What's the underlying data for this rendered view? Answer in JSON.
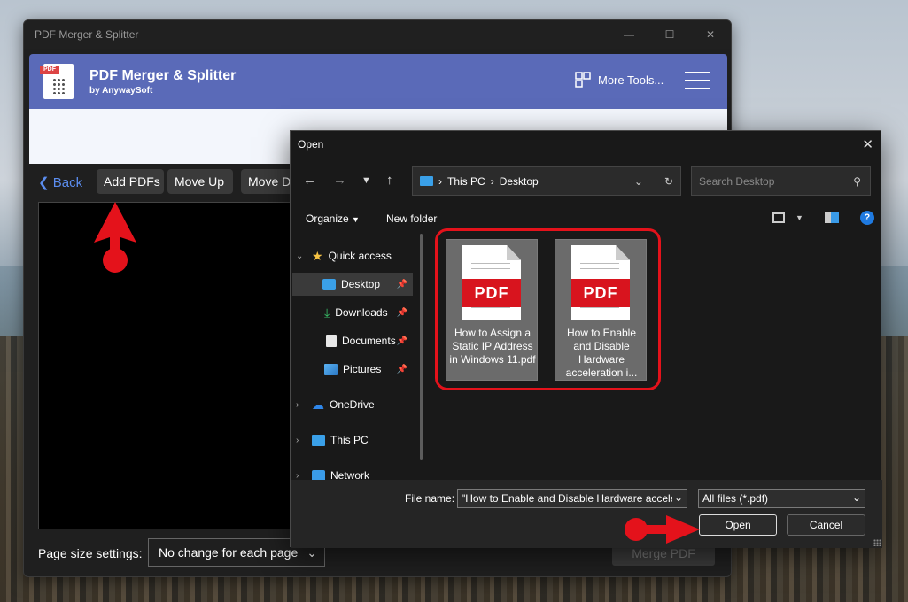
{
  "app": {
    "window_title": "PDF Merger & Splitter",
    "name": "PDF Merger & Splitter",
    "byline": "by AnywaySoft",
    "logo_tab": "PDF",
    "more_tools": "More Tools...",
    "toolbar": {
      "back": "Back",
      "add_pdfs": "Add PDFs",
      "move_up": "Move Up",
      "move_down": "Move D"
    },
    "page_size_label": "Page size settings:",
    "page_size_value": "No change for each page",
    "merge": "Merge PDF",
    "accent_color": "#5a6ab8"
  },
  "dialog": {
    "title": "Open",
    "breadcrumb": [
      "This PC",
      "Desktop"
    ],
    "search_placeholder": "Search Desktop",
    "organize": "Organize",
    "new_folder": "New folder",
    "nav": [
      {
        "label": "Quick access",
        "icon": "star-icon",
        "pinned": false
      },
      {
        "label": "Desktop",
        "icon": "desktop-icon",
        "pinned": true,
        "selected": true
      },
      {
        "label": "Downloads",
        "icon": "download-icon",
        "pinned": true
      },
      {
        "label": "Documents",
        "icon": "documents-icon",
        "pinned": true
      },
      {
        "label": "Pictures",
        "icon": "pictures-icon",
        "pinned": true
      },
      {
        "label": "OneDrive",
        "icon": "onedrive-icon",
        "pinned": false
      },
      {
        "label": "This PC",
        "icon": "this-pc-icon",
        "pinned": false
      },
      {
        "label": "Network",
        "icon": "network-icon",
        "pinned": false
      }
    ],
    "files": [
      {
        "name": "How to Assign a Static IP Address in Windows 11.pdf",
        "badge": "PDF"
      },
      {
        "name": "How to Enable and Disable Hardware acceleration i...",
        "badge": "PDF"
      }
    ],
    "file_name_label": "File name:",
    "file_name_value": "\"How to Enable and Disable Hardware accele",
    "file_type": "All files (*.pdf)",
    "open": "Open",
    "cancel": "Cancel",
    "highlight_color": "#e4121b"
  }
}
